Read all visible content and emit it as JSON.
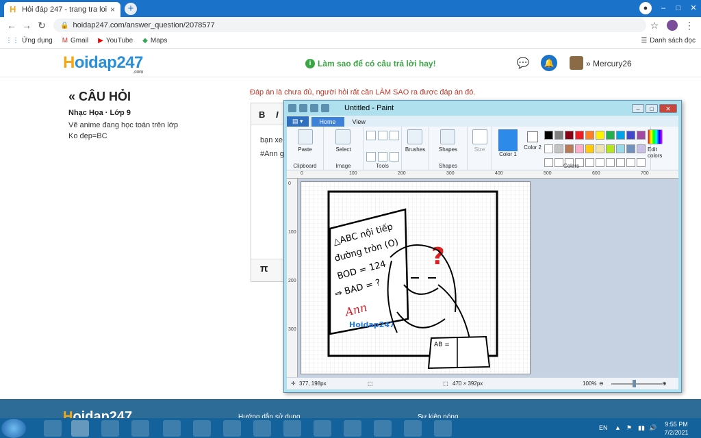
{
  "browser": {
    "tab_title": "Hỏi đáp 247 - trang tra loi",
    "new_tab": "+",
    "close_tab": "×",
    "url": "hoidap247.com/answer_question/2078577",
    "bookmarks": [
      {
        "label": "Ứng dụng",
        "icon": "apps-icon"
      },
      {
        "label": "Gmail",
        "icon": "gmail-icon"
      },
      {
        "label": "YouTube",
        "icon": "youtube-icon"
      },
      {
        "label": "Maps",
        "icon": "maps-icon"
      }
    ],
    "reading_list": "Danh sách đọc"
  },
  "site": {
    "logo_h": "H",
    "logo_rest": "oidap247",
    "logo_com": ".com",
    "tip": "Làm sao để có câu trả lời hay!",
    "username": "Mercury26"
  },
  "question": {
    "heading": "« CÂU HỎI",
    "subject": "Nhạc Họa · Lớp 9",
    "line1": "Vẽ anime đang học toán trên lớp",
    "line2": "Ko đẹp=BC"
  },
  "answer": {
    "warning": "Đáp án là chưa đủ, người hỏi rất cần LÀM SAO ra được đáp án đó.",
    "bold": "B",
    "italic": "I",
    "text1": "bạn xe",
    "text2": "#Ann g",
    "pi": "π"
  },
  "footer": {
    "logo_h": "H",
    "logo_rest": "oidap247",
    "link1": "Hướng dẫn sử dụng",
    "link2": "Sự kiện nóng"
  },
  "paint": {
    "title": "Untitled - Paint",
    "tabs": [
      "Home",
      "View"
    ],
    "groups": {
      "clipboard": "Clipboard",
      "image": "Image",
      "tools": "Tools",
      "shapes": "Shapes",
      "colors": "Colors"
    },
    "buttons": {
      "paste": "Paste",
      "select": "Select",
      "brushes": "Brushes",
      "shapes": "Shapes",
      "size": "Size",
      "color1": "Color 1",
      "color2": "Color 2",
      "edit_colors": "Edit colors"
    },
    "ruler_h": [
      "0",
      "100",
      "200",
      "300",
      "400",
      "500",
      "600",
      "700"
    ],
    "ruler_v": [
      "0",
      "100",
      "200",
      "300"
    ],
    "swatches": [
      "#000000",
      "#7f7f7f",
      "#880015",
      "#ed1c24",
      "#ff7f27",
      "#fff200",
      "#22b14c",
      "#00a2e8",
      "#3f48cc",
      "#a349a4",
      "#ffffff",
      "#c3c3c3",
      "#b97a57",
      "#ffaec9",
      "#ffc90e",
      "#efe4b0",
      "#b5e61d",
      "#99d9ea",
      "#7092be",
      "#c8bfe7",
      "#ffffff",
      "#ffffff",
      "#ffffff",
      "#ffffff",
      "#ffffff",
      "#ffffff",
      "#ffffff",
      "#ffffff",
      "#ffffff",
      "#ffffff"
    ],
    "status": {
      "cursor": "377, 198px",
      "size": "470 × 392px",
      "zoom": "100%"
    },
    "drawing": {
      "board_text1": "△ABC nội tiếp",
      "board_text2": "đường tròn (O)",
      "board_text3": "BOD = 124",
      "board_text4": "⇒ BAD = ?",
      "signature": "Ann",
      "watermark": "Hoidap247",
      "question_mark": "?",
      "book": "AB ="
    }
  },
  "taskbar": {
    "lang": "EN",
    "time": "9:55 PM",
    "date": "7/2/2021"
  }
}
